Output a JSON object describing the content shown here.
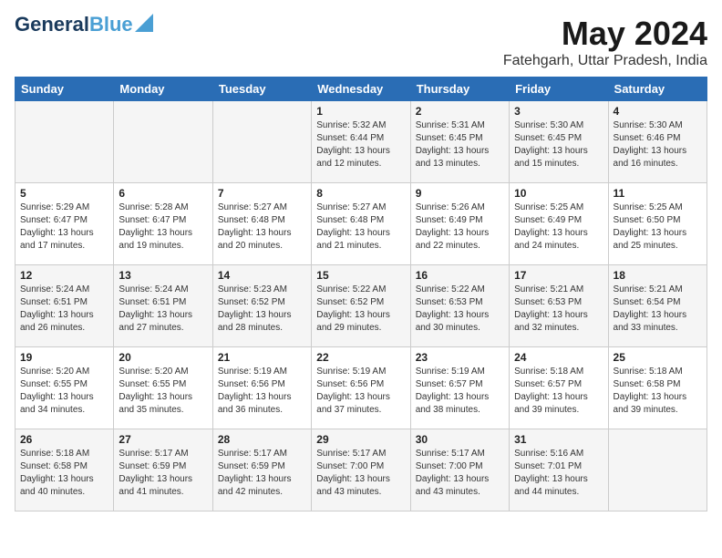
{
  "logo": {
    "text1": "General",
    "text2": "Blue"
  },
  "title": {
    "month_year": "May 2024",
    "location": "Fatehgarh, Uttar Pradesh, India"
  },
  "headers": [
    "Sunday",
    "Monday",
    "Tuesday",
    "Wednesday",
    "Thursday",
    "Friday",
    "Saturday"
  ],
  "weeks": [
    {
      "days": [
        {
          "number": "",
          "info": ""
        },
        {
          "number": "",
          "info": ""
        },
        {
          "number": "",
          "info": ""
        },
        {
          "number": "1",
          "info": "Sunrise: 5:32 AM\nSunset: 6:44 PM\nDaylight: 13 hours\nand 12 minutes."
        },
        {
          "number": "2",
          "info": "Sunrise: 5:31 AM\nSunset: 6:45 PM\nDaylight: 13 hours\nand 13 minutes."
        },
        {
          "number": "3",
          "info": "Sunrise: 5:30 AM\nSunset: 6:45 PM\nDaylight: 13 hours\nand 15 minutes."
        },
        {
          "number": "4",
          "info": "Sunrise: 5:30 AM\nSunset: 6:46 PM\nDaylight: 13 hours\nand 16 minutes."
        }
      ]
    },
    {
      "days": [
        {
          "number": "5",
          "info": "Sunrise: 5:29 AM\nSunset: 6:47 PM\nDaylight: 13 hours\nand 17 minutes."
        },
        {
          "number": "6",
          "info": "Sunrise: 5:28 AM\nSunset: 6:47 PM\nDaylight: 13 hours\nand 19 minutes."
        },
        {
          "number": "7",
          "info": "Sunrise: 5:27 AM\nSunset: 6:48 PM\nDaylight: 13 hours\nand 20 minutes."
        },
        {
          "number": "8",
          "info": "Sunrise: 5:27 AM\nSunset: 6:48 PM\nDaylight: 13 hours\nand 21 minutes."
        },
        {
          "number": "9",
          "info": "Sunrise: 5:26 AM\nSunset: 6:49 PM\nDaylight: 13 hours\nand 22 minutes."
        },
        {
          "number": "10",
          "info": "Sunrise: 5:25 AM\nSunset: 6:49 PM\nDaylight: 13 hours\nand 24 minutes."
        },
        {
          "number": "11",
          "info": "Sunrise: 5:25 AM\nSunset: 6:50 PM\nDaylight: 13 hours\nand 25 minutes."
        }
      ]
    },
    {
      "days": [
        {
          "number": "12",
          "info": "Sunrise: 5:24 AM\nSunset: 6:51 PM\nDaylight: 13 hours\nand 26 minutes."
        },
        {
          "number": "13",
          "info": "Sunrise: 5:24 AM\nSunset: 6:51 PM\nDaylight: 13 hours\nand 27 minutes."
        },
        {
          "number": "14",
          "info": "Sunrise: 5:23 AM\nSunset: 6:52 PM\nDaylight: 13 hours\nand 28 minutes."
        },
        {
          "number": "15",
          "info": "Sunrise: 5:22 AM\nSunset: 6:52 PM\nDaylight: 13 hours\nand 29 minutes."
        },
        {
          "number": "16",
          "info": "Sunrise: 5:22 AM\nSunset: 6:53 PM\nDaylight: 13 hours\nand 30 minutes."
        },
        {
          "number": "17",
          "info": "Sunrise: 5:21 AM\nSunset: 6:53 PM\nDaylight: 13 hours\nand 32 minutes."
        },
        {
          "number": "18",
          "info": "Sunrise: 5:21 AM\nSunset: 6:54 PM\nDaylight: 13 hours\nand 33 minutes."
        }
      ]
    },
    {
      "days": [
        {
          "number": "19",
          "info": "Sunrise: 5:20 AM\nSunset: 6:55 PM\nDaylight: 13 hours\nand 34 minutes."
        },
        {
          "number": "20",
          "info": "Sunrise: 5:20 AM\nSunset: 6:55 PM\nDaylight: 13 hours\nand 35 minutes."
        },
        {
          "number": "21",
          "info": "Sunrise: 5:19 AM\nSunset: 6:56 PM\nDaylight: 13 hours\nand 36 minutes."
        },
        {
          "number": "22",
          "info": "Sunrise: 5:19 AM\nSunset: 6:56 PM\nDaylight: 13 hours\nand 37 minutes."
        },
        {
          "number": "23",
          "info": "Sunrise: 5:19 AM\nSunset: 6:57 PM\nDaylight: 13 hours\nand 38 minutes."
        },
        {
          "number": "24",
          "info": "Sunrise: 5:18 AM\nSunset: 6:57 PM\nDaylight: 13 hours\nand 39 minutes."
        },
        {
          "number": "25",
          "info": "Sunrise: 5:18 AM\nSunset: 6:58 PM\nDaylight: 13 hours\nand 39 minutes."
        }
      ]
    },
    {
      "days": [
        {
          "number": "26",
          "info": "Sunrise: 5:18 AM\nSunset: 6:58 PM\nDaylight: 13 hours\nand 40 minutes."
        },
        {
          "number": "27",
          "info": "Sunrise: 5:17 AM\nSunset: 6:59 PM\nDaylight: 13 hours\nand 41 minutes."
        },
        {
          "number": "28",
          "info": "Sunrise: 5:17 AM\nSunset: 6:59 PM\nDaylight: 13 hours\nand 42 minutes."
        },
        {
          "number": "29",
          "info": "Sunrise: 5:17 AM\nSunset: 7:00 PM\nDaylight: 13 hours\nand 43 minutes."
        },
        {
          "number": "30",
          "info": "Sunrise: 5:17 AM\nSunset: 7:00 PM\nDaylight: 13 hours\nand 43 minutes."
        },
        {
          "number": "31",
          "info": "Sunrise: 5:16 AM\nSunset: 7:01 PM\nDaylight: 13 hours\nand 44 minutes."
        },
        {
          "number": "",
          "info": ""
        }
      ]
    }
  ]
}
